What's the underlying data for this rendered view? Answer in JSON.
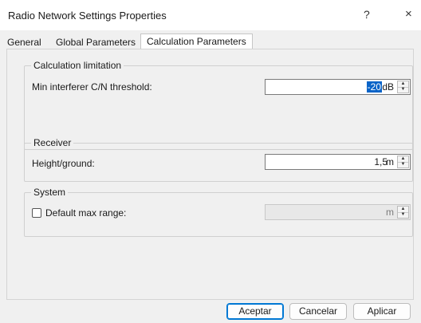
{
  "window": {
    "title": "Radio Network Settings Properties",
    "help_glyph": "?",
    "close_glyph": "×"
  },
  "tabs": [
    {
      "label": "General",
      "active": false
    },
    {
      "label": "Global Parameters",
      "active": false
    },
    {
      "label": "Calculation Parameters",
      "active": true
    }
  ],
  "groups": {
    "calc": {
      "label": "Calculation limitation",
      "field_label": "Min interferer C/N threshold:",
      "value": "-20",
      "unit": "dB"
    },
    "receiver": {
      "label": "Receiver",
      "field_label": "Height/ground:",
      "value": "1,5",
      "unit": "m"
    },
    "system": {
      "label": "System",
      "checkbox_label": "Default max range:",
      "checked": false,
      "value": "",
      "unit": "m"
    }
  },
  "buttons": {
    "ok": "Aceptar",
    "cancel": "Cancelar",
    "apply": "Aplicar"
  },
  "colors": {
    "accent": "#0078d4",
    "selection": "#0a64c8"
  }
}
